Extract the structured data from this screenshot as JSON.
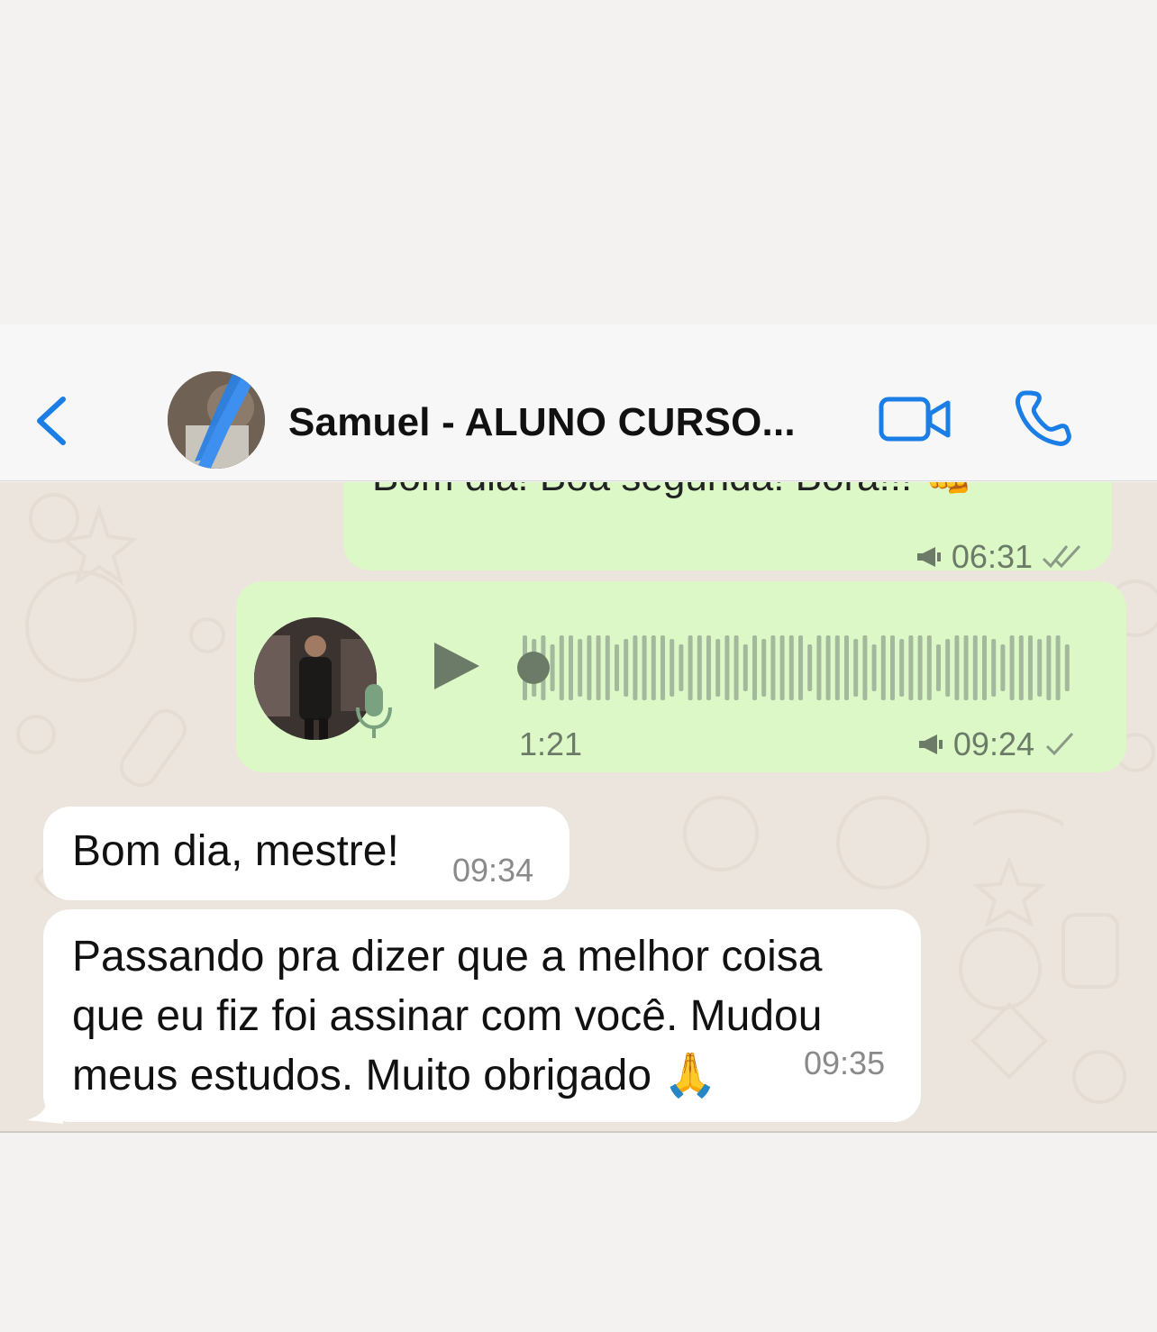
{
  "header": {
    "contact_name": "Samuel - ALUNO CURSO...",
    "back_icon": "chevron-left-icon",
    "video_icon": "video-camera-icon",
    "call_icon": "phone-icon",
    "accent_color": "#1a7ee6"
  },
  "messages": [
    {
      "direction": "outgoing",
      "text": "Bom dia! Boa segunda! Bora!!! 👊",
      "time": "06:31",
      "status": "read",
      "status_icon": "double-check-icon",
      "broadcast_icon": "megaphone-icon"
    },
    {
      "direction": "outgoing",
      "type": "voice",
      "duration": "1:21",
      "time": "09:24",
      "status": "sent",
      "status_icon": "single-check-icon",
      "broadcast_icon": "megaphone-icon",
      "play_icon": "play-icon",
      "mic_icon": "microphone-icon"
    },
    {
      "direction": "incoming",
      "text": "Bom dia, mestre!",
      "time": "09:34"
    },
    {
      "direction": "incoming",
      "text": "Passando pra dizer que a melhor coisa que eu fiz foi assinar com você. Mudou meus estudos. Muito obrigado 🙏",
      "time": "09:35"
    }
  ],
  "colors": {
    "outgoing_bubble": "#dcf8c6",
    "incoming_bubble": "#ffffff",
    "chat_background": "#ece5dd"
  }
}
